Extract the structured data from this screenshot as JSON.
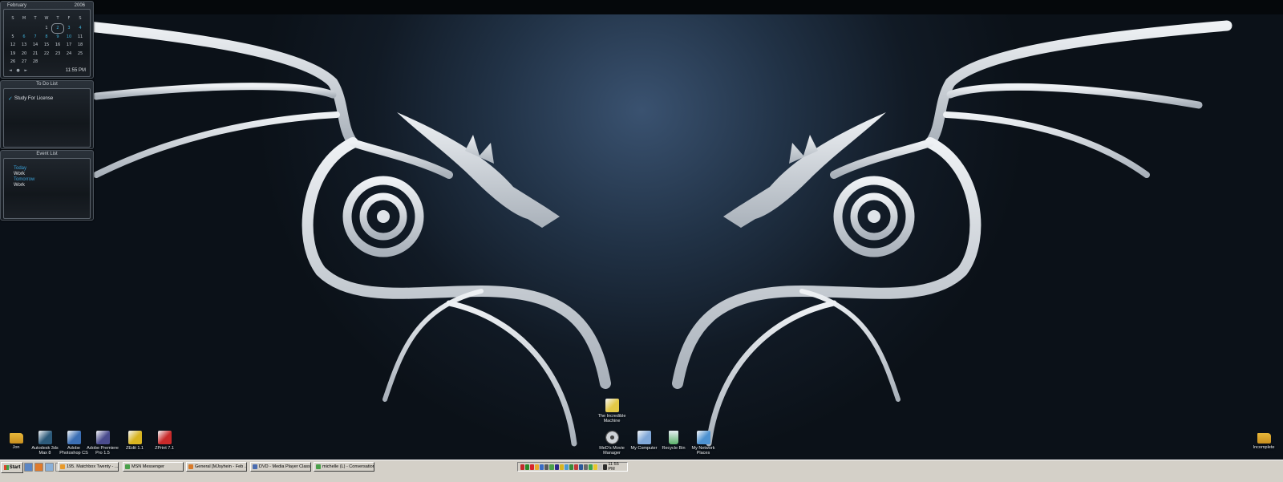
{
  "calendar": {
    "month": "February",
    "year": "2006",
    "weekdays": [
      "S",
      "M",
      "T",
      "W",
      "T",
      "F",
      "S"
    ],
    "days": [
      "",
      "",
      "",
      "1",
      "2",
      "3",
      "4",
      "5",
      "6",
      "7",
      "8",
      "9",
      "10",
      "11",
      "12",
      "13",
      "14",
      "15",
      "16",
      "17",
      "18",
      "19",
      "20",
      "21",
      "22",
      "23",
      "24",
      "25",
      "26",
      "27",
      "28"
    ],
    "highlight_days": [
      "2",
      "3",
      "4",
      "6",
      "7",
      "8",
      "9",
      "10"
    ],
    "today": "2",
    "nav": "◄ ● ►",
    "time": "11:55 PM"
  },
  "todo": {
    "title": "To Do List",
    "items": [
      {
        "label": "Study For License"
      }
    ]
  },
  "events": {
    "title": "Event List",
    "entries": [
      {
        "text": "Today",
        "type": "header"
      },
      {
        "text": "Work",
        "type": "item"
      },
      {
        "text": "Tomorrow",
        "type": "header"
      },
      {
        "text": "Work",
        "type": "item"
      }
    ]
  },
  "desktop_icons": [
    {
      "name": "icon-jon",
      "label": "Jon",
      "icon": "folder-icon",
      "color": "#e8b73a"
    },
    {
      "name": "icon-3dsmax",
      "label": "Autodesk 3ds Max 8",
      "icon": "3dsmax-icon",
      "color": "#2c5a7a"
    },
    {
      "name": "icon-photoshop",
      "label": "Adobe Photoshop CS",
      "icon": "photoshop-icon",
      "color": "#3b6fb5"
    },
    {
      "name": "icon-premiere",
      "label": "Adobe Premiere Pro 1.5",
      "icon": "premiere-icon",
      "color": "#4a4c8e"
    },
    {
      "name": "icon-zedit",
      "label": "ZEdit 1.1",
      "icon": "zedit-icon",
      "color": "#d8b420"
    },
    {
      "name": "icon-zprint",
      "label": "ZPrint 7.1",
      "icon": "zprint-icon",
      "color": "#c92a2a"
    },
    {
      "name": "icon-incredible-machine",
      "label": "The Incredible Machine",
      "icon": "incredible-machine-icon",
      "color": "#e3c846"
    },
    {
      "name": "icon-movie-manager",
      "label": "MeD's Movie Manager",
      "icon": "film-reel-icon",
      "color": "#cfd3d8"
    },
    {
      "name": "icon-my-computer",
      "label": "My Computer",
      "icon": "computer-icon",
      "color": "#7fa7d8"
    },
    {
      "name": "icon-recycle-bin",
      "label": "Recycle Bin",
      "icon": "recycle-bin-icon",
      "color": "#5bb26a"
    },
    {
      "name": "icon-network-places",
      "label": "My Network Places",
      "icon": "network-icon",
      "color": "#4d92d1"
    },
    {
      "name": "icon-incomplete",
      "label": "Incomplete",
      "icon": "folder-icon",
      "color": "#e8b73a"
    }
  ],
  "taskbar": {
    "start_label": "Start",
    "quicklaunch": [
      {
        "icon": "desktop-icon",
        "color": "#5b86c4"
      },
      {
        "icon": "firefox-icon",
        "color": "#e07a2b"
      },
      {
        "icon": "document-icon",
        "color": "#8ab0d8"
      },
      {
        "icon": "chevron-icon",
        "color": "#d4d0c8"
      }
    ],
    "tasks": [
      {
        "name": "task-matchbox",
        "label": "195. Matchbox Twenty - ...",
        "icon": "media-icon",
        "color": "#e89a2b"
      },
      {
        "name": "task-msn",
        "label": "MSN Messenger",
        "icon": "msn-icon",
        "color": "#4aa04a"
      },
      {
        "name": "task-general",
        "label": "General [MJsyhein - Feb ...",
        "icon": "chat-icon",
        "color": "#d87a2a"
      },
      {
        "name": "task-dvd",
        "label": "DVD - Media Player Classic",
        "icon": "dvd-icon",
        "color": "#4a6cb0"
      },
      {
        "name": "task-conversation",
        "label": "michelle (L) - Conversation",
        "icon": "msn-icon",
        "color": "#4aa04a"
      }
    ],
    "tray_icons": [
      "#c22a2a",
      "#2a8a2a",
      "#d8232a",
      "#e8a92b",
      "#3a6cc4",
      "#5a5a5a",
      "#4aa04a",
      "#2a2a8a",
      "#d8b420",
      "#4a9ad0",
      "#3a8a3a",
      "#c23a3a",
      "#2a5a9a",
      "#6a6a6a",
      "#3aa44a",
      "#e8c82b",
      "#c2c2c2",
      "#2a2a2a"
    ],
    "clock": "11:55 PM"
  }
}
